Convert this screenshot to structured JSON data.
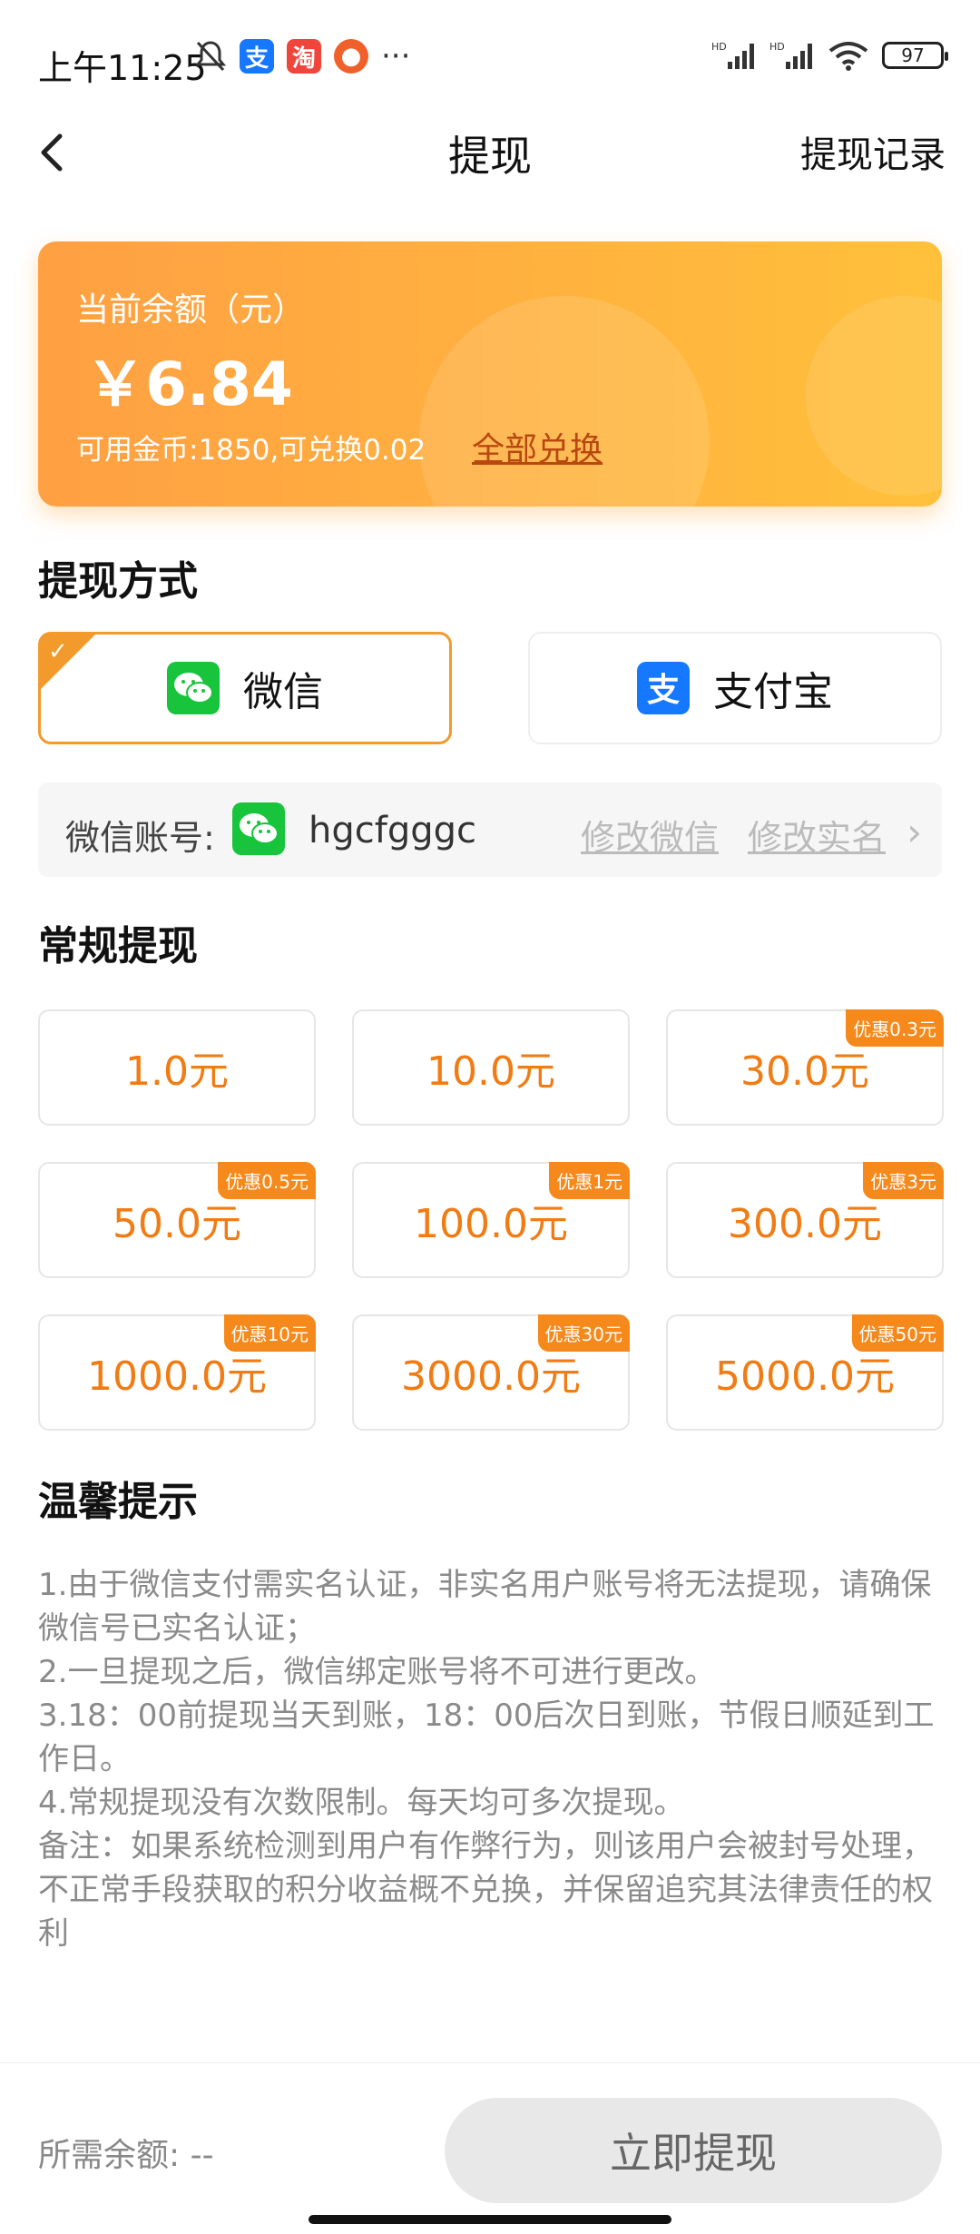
{
  "status": {
    "time": "上午11:25",
    "battery": "97",
    "hd1": "HD",
    "hd2": "HD",
    "more": "···"
  },
  "header": {
    "title": "提现",
    "record_label": "提现记录"
  },
  "balance": {
    "label": "当前余额（元）",
    "amount": "￥6.84",
    "coins_text": "可用金币:1850,可兑换0.02",
    "exchange_all": "全部兑换"
  },
  "methods": {
    "section_title": "提现方式",
    "wechat_label": "微信",
    "alipay_label": "支付宝"
  },
  "account": {
    "label": "微信账号:",
    "name": "hgcfgggc",
    "edit_wechat": "修改微信",
    "edit_realname": "修改实名"
  },
  "regular": {
    "section_title": "常规提现",
    "amounts": [
      {
        "label": "1.0元",
        "badge": ""
      },
      {
        "label": "10.0元",
        "badge": ""
      },
      {
        "label": "30.0元",
        "badge": "优惠0.3元"
      },
      {
        "label": "50.0元",
        "badge": "优惠0.5元"
      },
      {
        "label": "100.0元",
        "badge": "优惠1元"
      },
      {
        "label": "300.0元",
        "badge": "优惠3元"
      },
      {
        "label": "1000.0元",
        "badge": "优惠10元"
      },
      {
        "label": "3000.0元",
        "badge": "优惠30元"
      },
      {
        "label": "5000.0元",
        "badge": "优惠50元"
      }
    ]
  },
  "tips": {
    "section_title": "温馨提示",
    "lines": [
      "1.由于微信支付需实名认证，非实名用户账号将无法提现，请确保微信号已实名认证；",
      "2.一旦提现之后，微信绑定账号将不可进行更改。",
      "3.18：00前提现当天到账，18：00后次日到账，节假日顺延到工作日。",
      "4.常规提现没有次数限制。每天均可多次提现。",
      "备注：如果系统检测到用户有作弊行为，则该用户会被封号处理，不正常手段获取的积分收益概不兑换，并保留追究其法律责任的权利"
    ]
  },
  "bottom": {
    "required_label": "所需余额: --",
    "submit_label": "立即提现"
  },
  "colors": {
    "accent": "#f07c13",
    "card_start": "#ffa043",
    "card_end": "#ffc13b",
    "wechat_green": "#18c43c",
    "alipay_blue": "#1677ff"
  }
}
